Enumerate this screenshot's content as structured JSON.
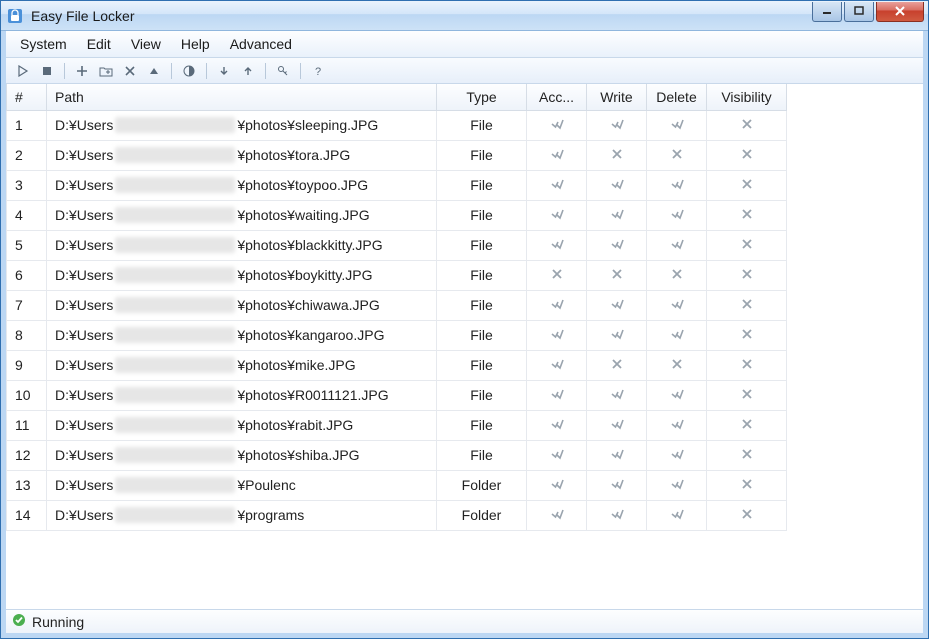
{
  "window": {
    "title": "Easy File Locker"
  },
  "menu": {
    "items": [
      "System",
      "Edit",
      "View",
      "Help",
      "Advanced"
    ]
  },
  "toolbar": {
    "buttons": [
      {
        "name": "play-icon"
      },
      {
        "name": "stop-icon"
      },
      {
        "sep": true
      },
      {
        "name": "add-icon"
      },
      {
        "name": "add-folder-icon"
      },
      {
        "name": "remove-icon"
      },
      {
        "name": "up-triangle-icon"
      },
      {
        "sep": true
      },
      {
        "name": "contrast-icon"
      },
      {
        "sep": true
      },
      {
        "name": "arrow-down-icon"
      },
      {
        "name": "arrow-up-icon"
      },
      {
        "sep": true
      },
      {
        "name": "key-icon"
      },
      {
        "sep": true
      },
      {
        "name": "help-icon"
      }
    ]
  },
  "columns": {
    "num": "#",
    "path": "Path",
    "type": "Type",
    "access": "Acc...",
    "write": "Write",
    "delete": "Delete",
    "visibility": "Visibility"
  },
  "rows": [
    {
      "num": "1",
      "prefix": "D:¥Users",
      "suffix": "¥photos¥sleeping.JPG",
      "type": "File",
      "access": true,
      "write": true,
      "delete": true,
      "visibility": false
    },
    {
      "num": "2",
      "prefix": "D:¥Users",
      "suffix": "¥photos¥tora.JPG",
      "type": "File",
      "access": true,
      "write": false,
      "delete": false,
      "visibility": false
    },
    {
      "num": "3",
      "prefix": "D:¥Users",
      "suffix": "¥photos¥toypoo.JPG",
      "type": "File",
      "access": true,
      "write": true,
      "delete": true,
      "visibility": false
    },
    {
      "num": "4",
      "prefix": "D:¥Users",
      "suffix": "¥photos¥waiting.JPG",
      "type": "File",
      "access": true,
      "write": true,
      "delete": true,
      "visibility": false
    },
    {
      "num": "5",
      "prefix": "D:¥Users",
      "suffix": "¥photos¥blackkitty.JPG",
      "type": "File",
      "access": true,
      "write": true,
      "delete": true,
      "visibility": false
    },
    {
      "num": "6",
      "prefix": "D:¥Users",
      "suffix": "¥photos¥boykitty.JPG",
      "type": "File",
      "access": false,
      "write": false,
      "delete": false,
      "visibility": false
    },
    {
      "num": "7",
      "prefix": "D:¥Users",
      "suffix": "¥photos¥chiwawa.JPG",
      "type": "File",
      "access": true,
      "write": true,
      "delete": true,
      "visibility": false
    },
    {
      "num": "8",
      "prefix": "D:¥Users",
      "suffix": "¥photos¥kangaroo.JPG",
      "type": "File",
      "access": true,
      "write": true,
      "delete": true,
      "visibility": false
    },
    {
      "num": "9",
      "prefix": "D:¥Users",
      "suffix": "¥photos¥mike.JPG",
      "type": "File",
      "access": true,
      "write": false,
      "delete": false,
      "visibility": false
    },
    {
      "num": "10",
      "prefix": "D:¥Users",
      "suffix": "¥photos¥R0011121.JPG",
      "type": "File",
      "access": true,
      "write": true,
      "delete": true,
      "visibility": false
    },
    {
      "num": "11",
      "prefix": "D:¥Users",
      "suffix": "¥photos¥rabit.JPG",
      "type": "File",
      "access": true,
      "write": true,
      "delete": true,
      "visibility": false
    },
    {
      "num": "12",
      "prefix": "D:¥Users",
      "suffix": "¥photos¥shiba.JPG",
      "type": "File",
      "access": true,
      "write": true,
      "delete": true,
      "visibility": false
    },
    {
      "num": "13",
      "prefix": "D:¥Users",
      "suffix": "¥Poulenc",
      "type": "Folder",
      "access": true,
      "write": true,
      "delete": true,
      "visibility": false
    },
    {
      "num": "14",
      "prefix": "D:¥Users",
      "suffix": "¥programs",
      "type": "Folder",
      "access": true,
      "write": true,
      "delete": true,
      "visibility": false
    }
  ],
  "status": {
    "text": "Running"
  }
}
